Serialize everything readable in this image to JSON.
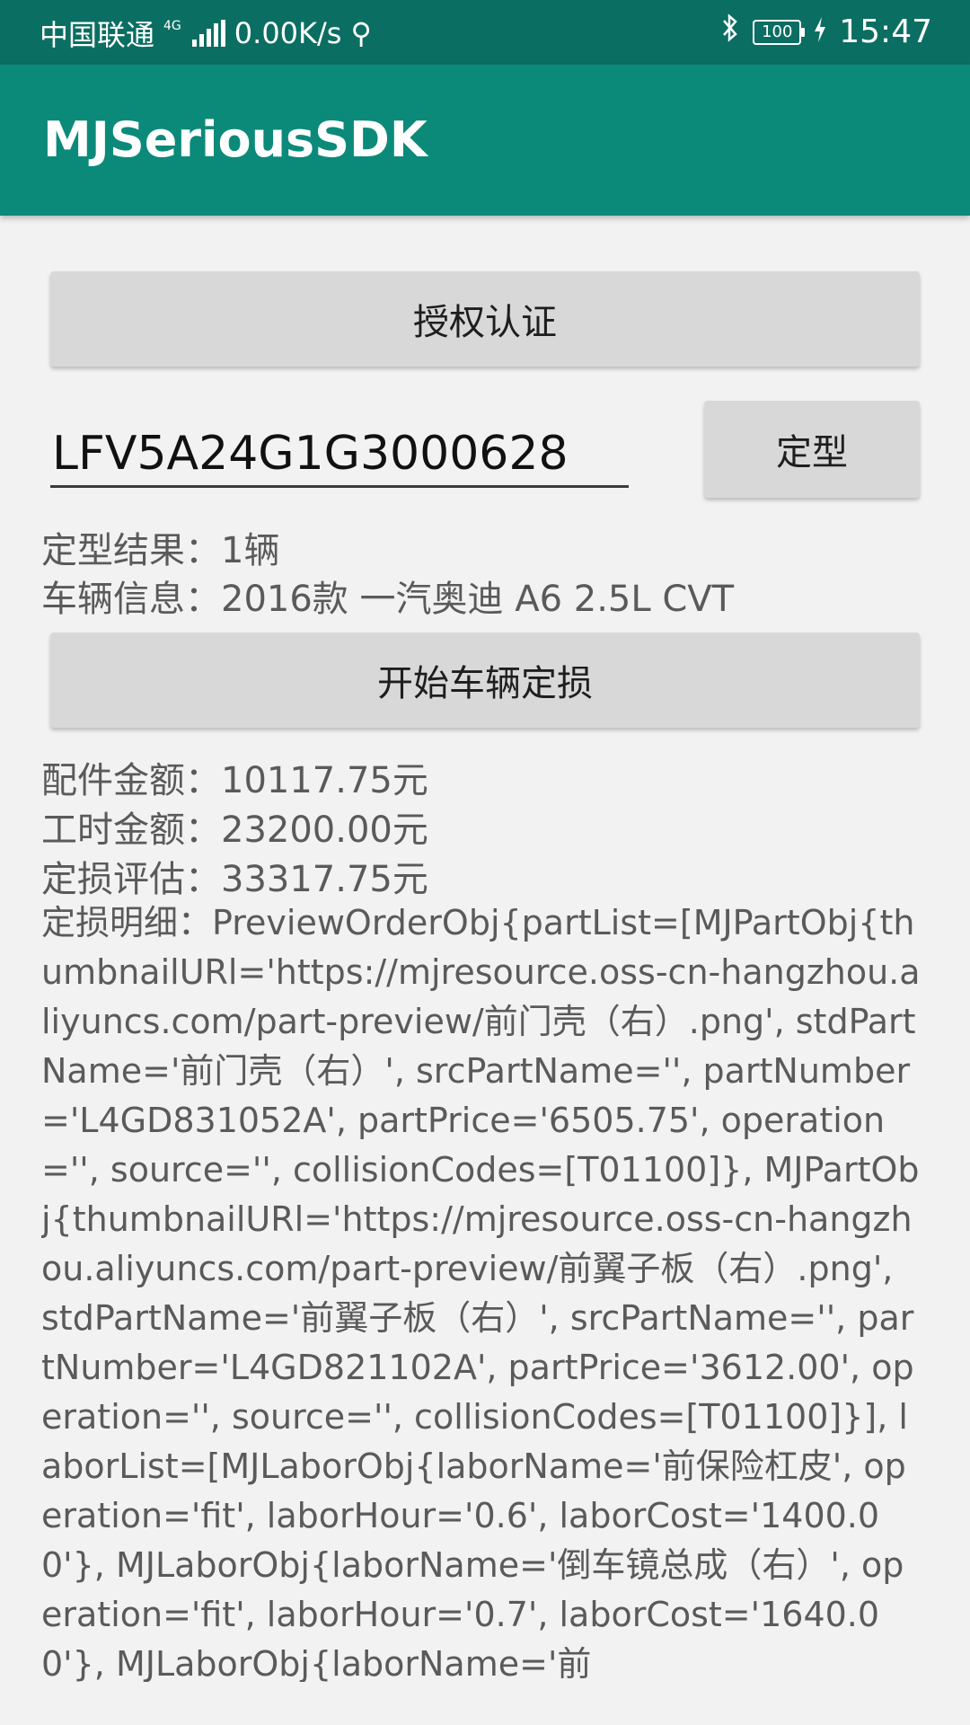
{
  "status_bar": {
    "carrier": "中国联通",
    "network_type": "4G",
    "speed": "0.00K/s",
    "battery": "100",
    "time": "15:47"
  },
  "app_bar": {
    "title": "MJSeriousSDK"
  },
  "buttons": {
    "auth": "授权认证",
    "identify": "定型",
    "start_damage": "开始车辆定损"
  },
  "vin_input": {
    "value": "LFV5A24G1G3000628"
  },
  "result": {
    "count": "定型结果：1辆",
    "vehicle": "车辆信息：2016款 一汽奥迪 A6 2.5L CVT"
  },
  "amounts": {
    "parts": "配件金额：10117.75元",
    "labor": "工时金额：23200.00元",
    "estimate": "定损评估：33317.75元"
  },
  "detail": "定损明细：PreviewOrderObj{partList=[MJPartObj{thumbnailURl='https://mjresource.oss-cn-hangzhou.aliyuncs.com/part-preview/前门壳（右）.png', stdPartName='前门壳（右）', srcPartName='', partNumber='L4GD831052A', partPrice='6505.75', operation='', source='', collisionCodes=[T01100]}, MJPartObj{thumbnailURl='https://mjresource.oss-cn-hangzhou.aliyuncs.com/part-preview/前翼子板（右）.png', stdPartName='前翼子板（右）', srcPartName='', partNumber='L4GD821102A', partPrice='3612.00', operation='', source='', collisionCodes=[T01100]}], laborList=[MJLaborObj{laborName='前保险杠皮', operation='fit', laborHour='0.6', laborCost='1400.00'}, MJLaborObj{laborName='倒车镜总成（右）', operation='fit', laborHour='0.7', laborCost='1640.00'}, MJLaborObj{laborName='前"
}
